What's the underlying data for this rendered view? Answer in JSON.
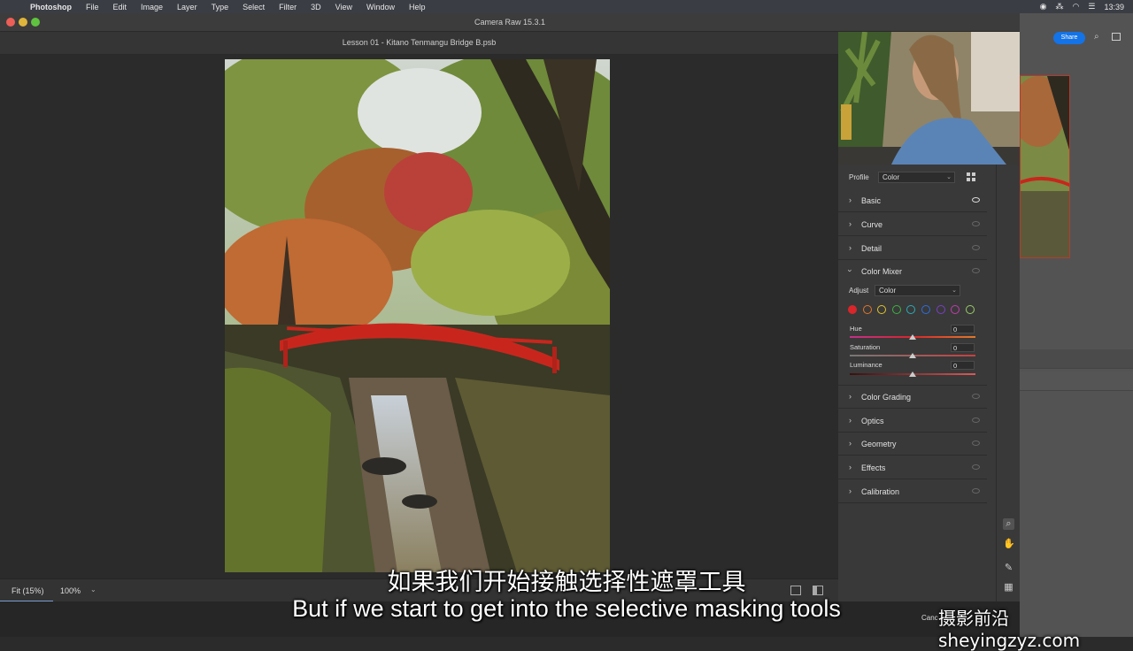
{
  "menubar": {
    "app": "Photoshop",
    "items": [
      "File",
      "Edit",
      "Image",
      "Layer",
      "Type",
      "Select",
      "Filter",
      "3D",
      "View",
      "Window",
      "Help"
    ],
    "time": "13:39"
  },
  "window": {
    "title": "Camera Raw 15.3.1"
  },
  "document": {
    "name": "Lesson 01 - Kitano Tenmangu Bridge B.psb"
  },
  "bottombar": {
    "fit_label": "Fit (15%)",
    "zoom_value": "100%"
  },
  "panel": {
    "profile_label": "Profile",
    "profile_value": "Color",
    "sections_top": [
      {
        "label": "Basic",
        "visible": true
      },
      {
        "label": "Curve",
        "visible": false
      },
      {
        "label": "Detail",
        "visible": false
      }
    ],
    "color_mixer": {
      "label": "Color Mixer",
      "adjust_label": "Adjust",
      "adjust_value": "Color",
      "swatches": [
        "#d8262a",
        "#e2772a",
        "#e2c52a",
        "#3cb443",
        "#2aaeb8",
        "#2d6ee0",
        "#7b3fc8",
        "#c23cb0",
        "#ffffff"
      ],
      "sliders": [
        {
          "label": "Hue",
          "value": "0"
        },
        {
          "label": "Saturation",
          "value": "0"
        },
        {
          "label": "Luminance",
          "value": "0"
        }
      ]
    },
    "sections_bottom": [
      {
        "label": "Color Grading"
      },
      {
        "label": "Optics"
      },
      {
        "label": "Geometry"
      },
      {
        "label": "Effects"
      },
      {
        "label": "Calibration"
      }
    ],
    "cancel_label": "Canc"
  },
  "ps_right": {
    "share_label": "Share"
  },
  "subtitles": {
    "zh": "如果我们开始接触选择性遮罩工具",
    "en": "But if we start to get into the selective masking tools"
  },
  "watermark": "摄影前沿 sheyingzyz.com"
}
